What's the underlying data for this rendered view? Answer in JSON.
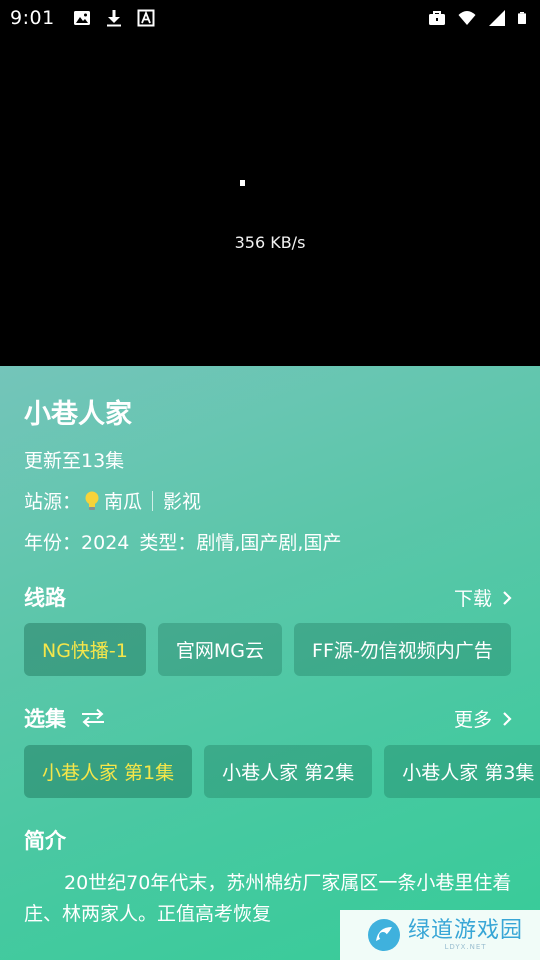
{
  "status_bar": {
    "time": "9:01",
    "left_icons": [
      "image-icon",
      "download-icon",
      "font-icon"
    ],
    "right_icons": [
      "briefcase-icon",
      "wifi-icon",
      "signal-icon",
      "battery-icon"
    ]
  },
  "player": {
    "net_speed": "356 KB/s"
  },
  "details": {
    "title": "小巷人家",
    "update_status": "更新至13集",
    "source_label": "站源：",
    "source_name": "南瓜",
    "source_type": "影视",
    "year_label": "年份：",
    "year": "2024",
    "type_label": "类型：",
    "genres": "剧情,国产剧,国产"
  },
  "routes": {
    "title": "线路",
    "download_label": "下载",
    "items": [
      "NG快播-1",
      "官网MG云",
      "FF源-勿信视频内广告"
    ],
    "active_index": 0
  },
  "episodes": {
    "title": "选集",
    "more_label": "更多",
    "items": [
      "小巷人家 第1集",
      "小巷人家 第2集",
      "小巷人家 第3集"
    ],
    "active_index": 0
  },
  "intro": {
    "title": "简介",
    "text": "20世纪70年代末，苏州棉纺厂家属区一条小巷里住着庄、林两家人。正值高考恢复"
  },
  "watermark": {
    "name": "绿道游戏园",
    "sub": "LDYX.NET"
  },
  "colors": {
    "accent_active": "#f5e64a",
    "panel_gradient_start": "#74c5ba",
    "panel_gradient_end": "#37cc98"
  }
}
